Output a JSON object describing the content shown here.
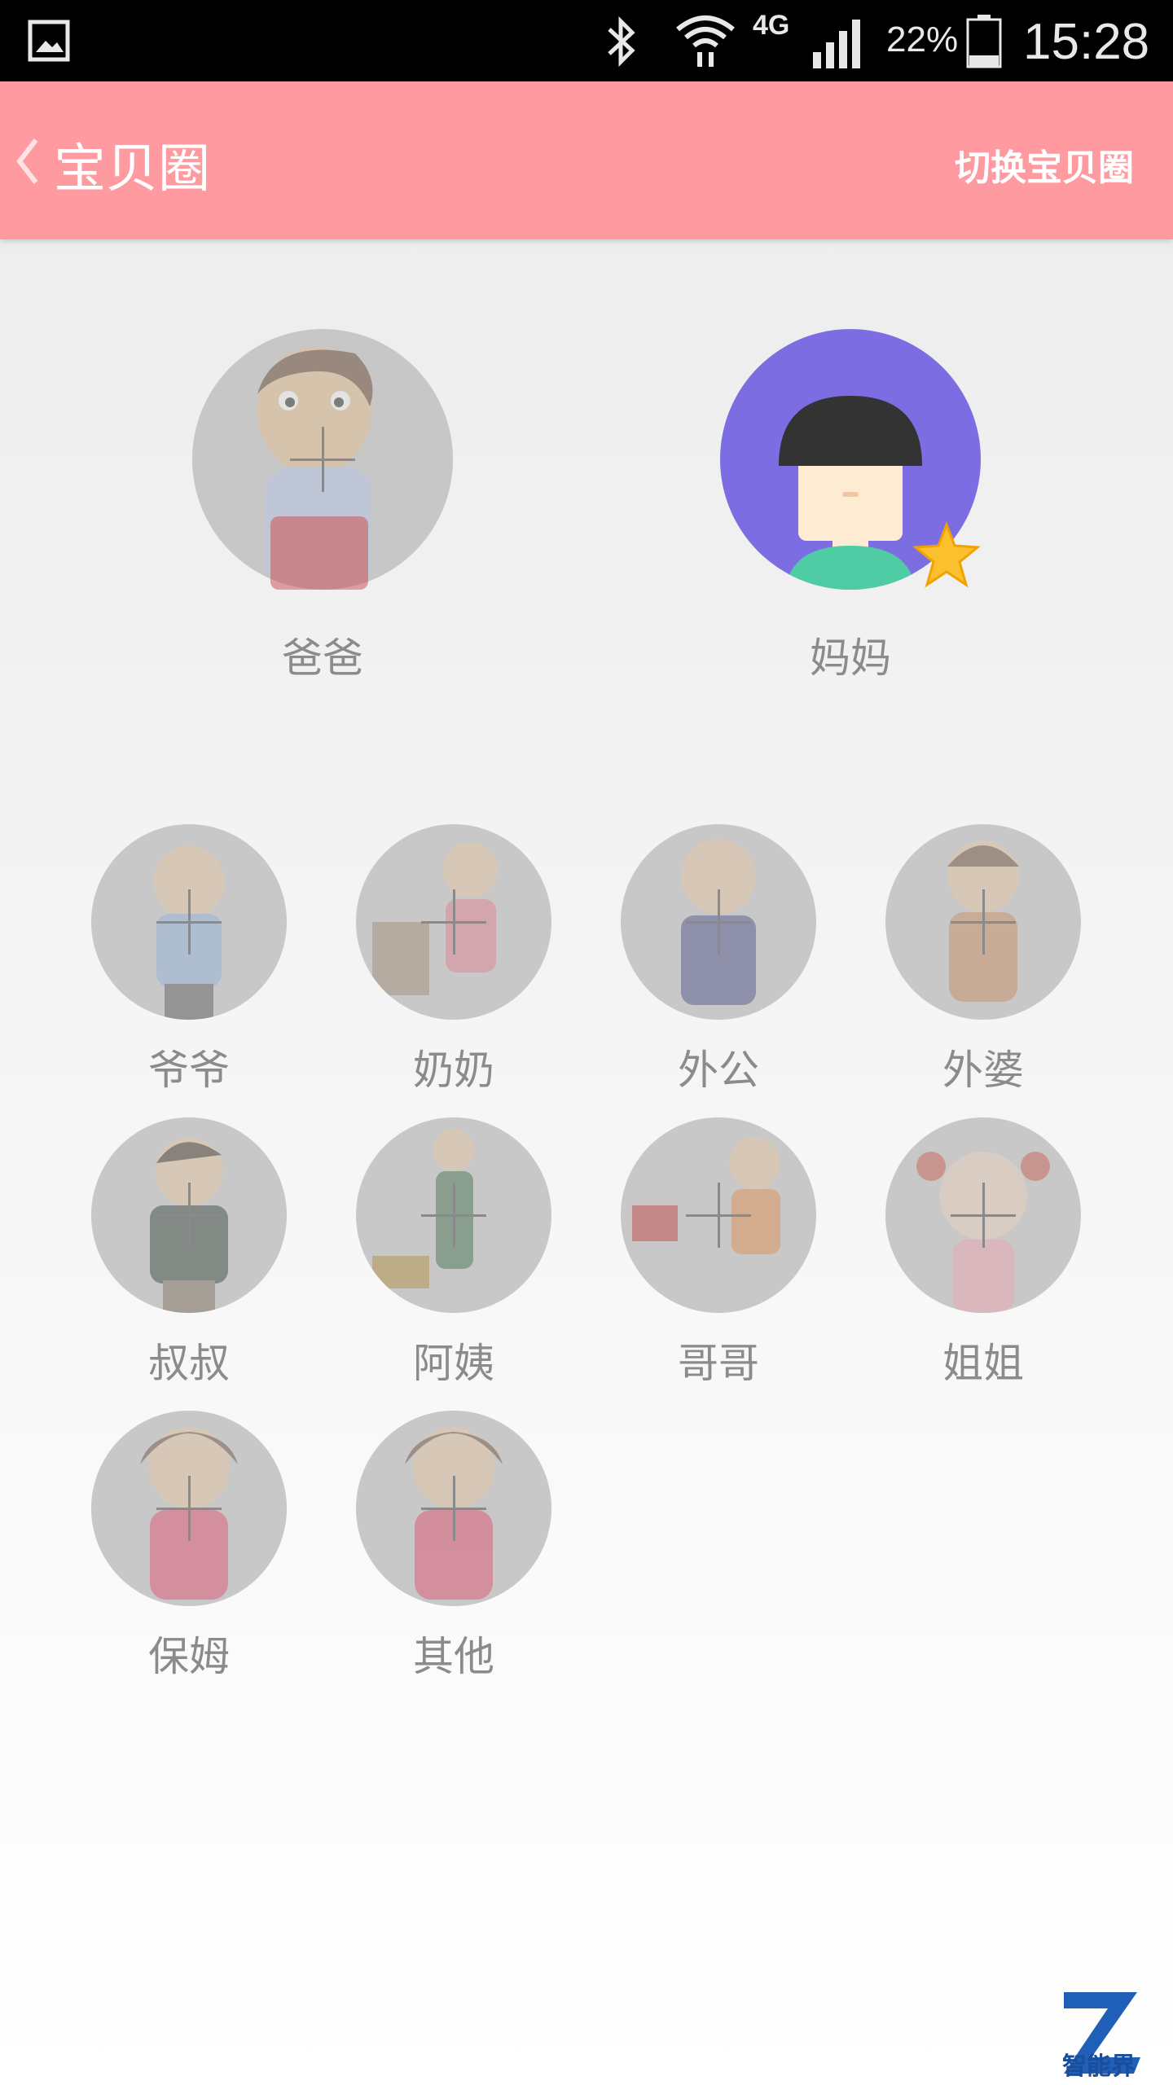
{
  "status_bar": {
    "network": "4G",
    "battery": "22%",
    "time": "15:28",
    "icons": [
      "gallery-icon",
      "bluetooth-icon",
      "wifi-icon",
      "signal-icon",
      "battery-icon"
    ]
  },
  "header": {
    "title": "宝贝圈",
    "switch_label": "切换宝贝圈",
    "accent_color": "#ff9aa1"
  },
  "parents": [
    {
      "label": "爸爸"
    },
    {
      "label": "妈妈"
    }
  ],
  "members": [
    {
      "label": "爷爷"
    },
    {
      "label": "奶奶"
    },
    {
      "label": "外公"
    },
    {
      "label": "外婆"
    },
    {
      "label": "叔叔"
    },
    {
      "label": "阿姨"
    },
    {
      "label": "哥哥"
    },
    {
      "label": "姐姐"
    },
    {
      "label": "保姆"
    },
    {
      "label": "其他"
    }
  ],
  "watermark": {
    "text": "智能界"
  }
}
